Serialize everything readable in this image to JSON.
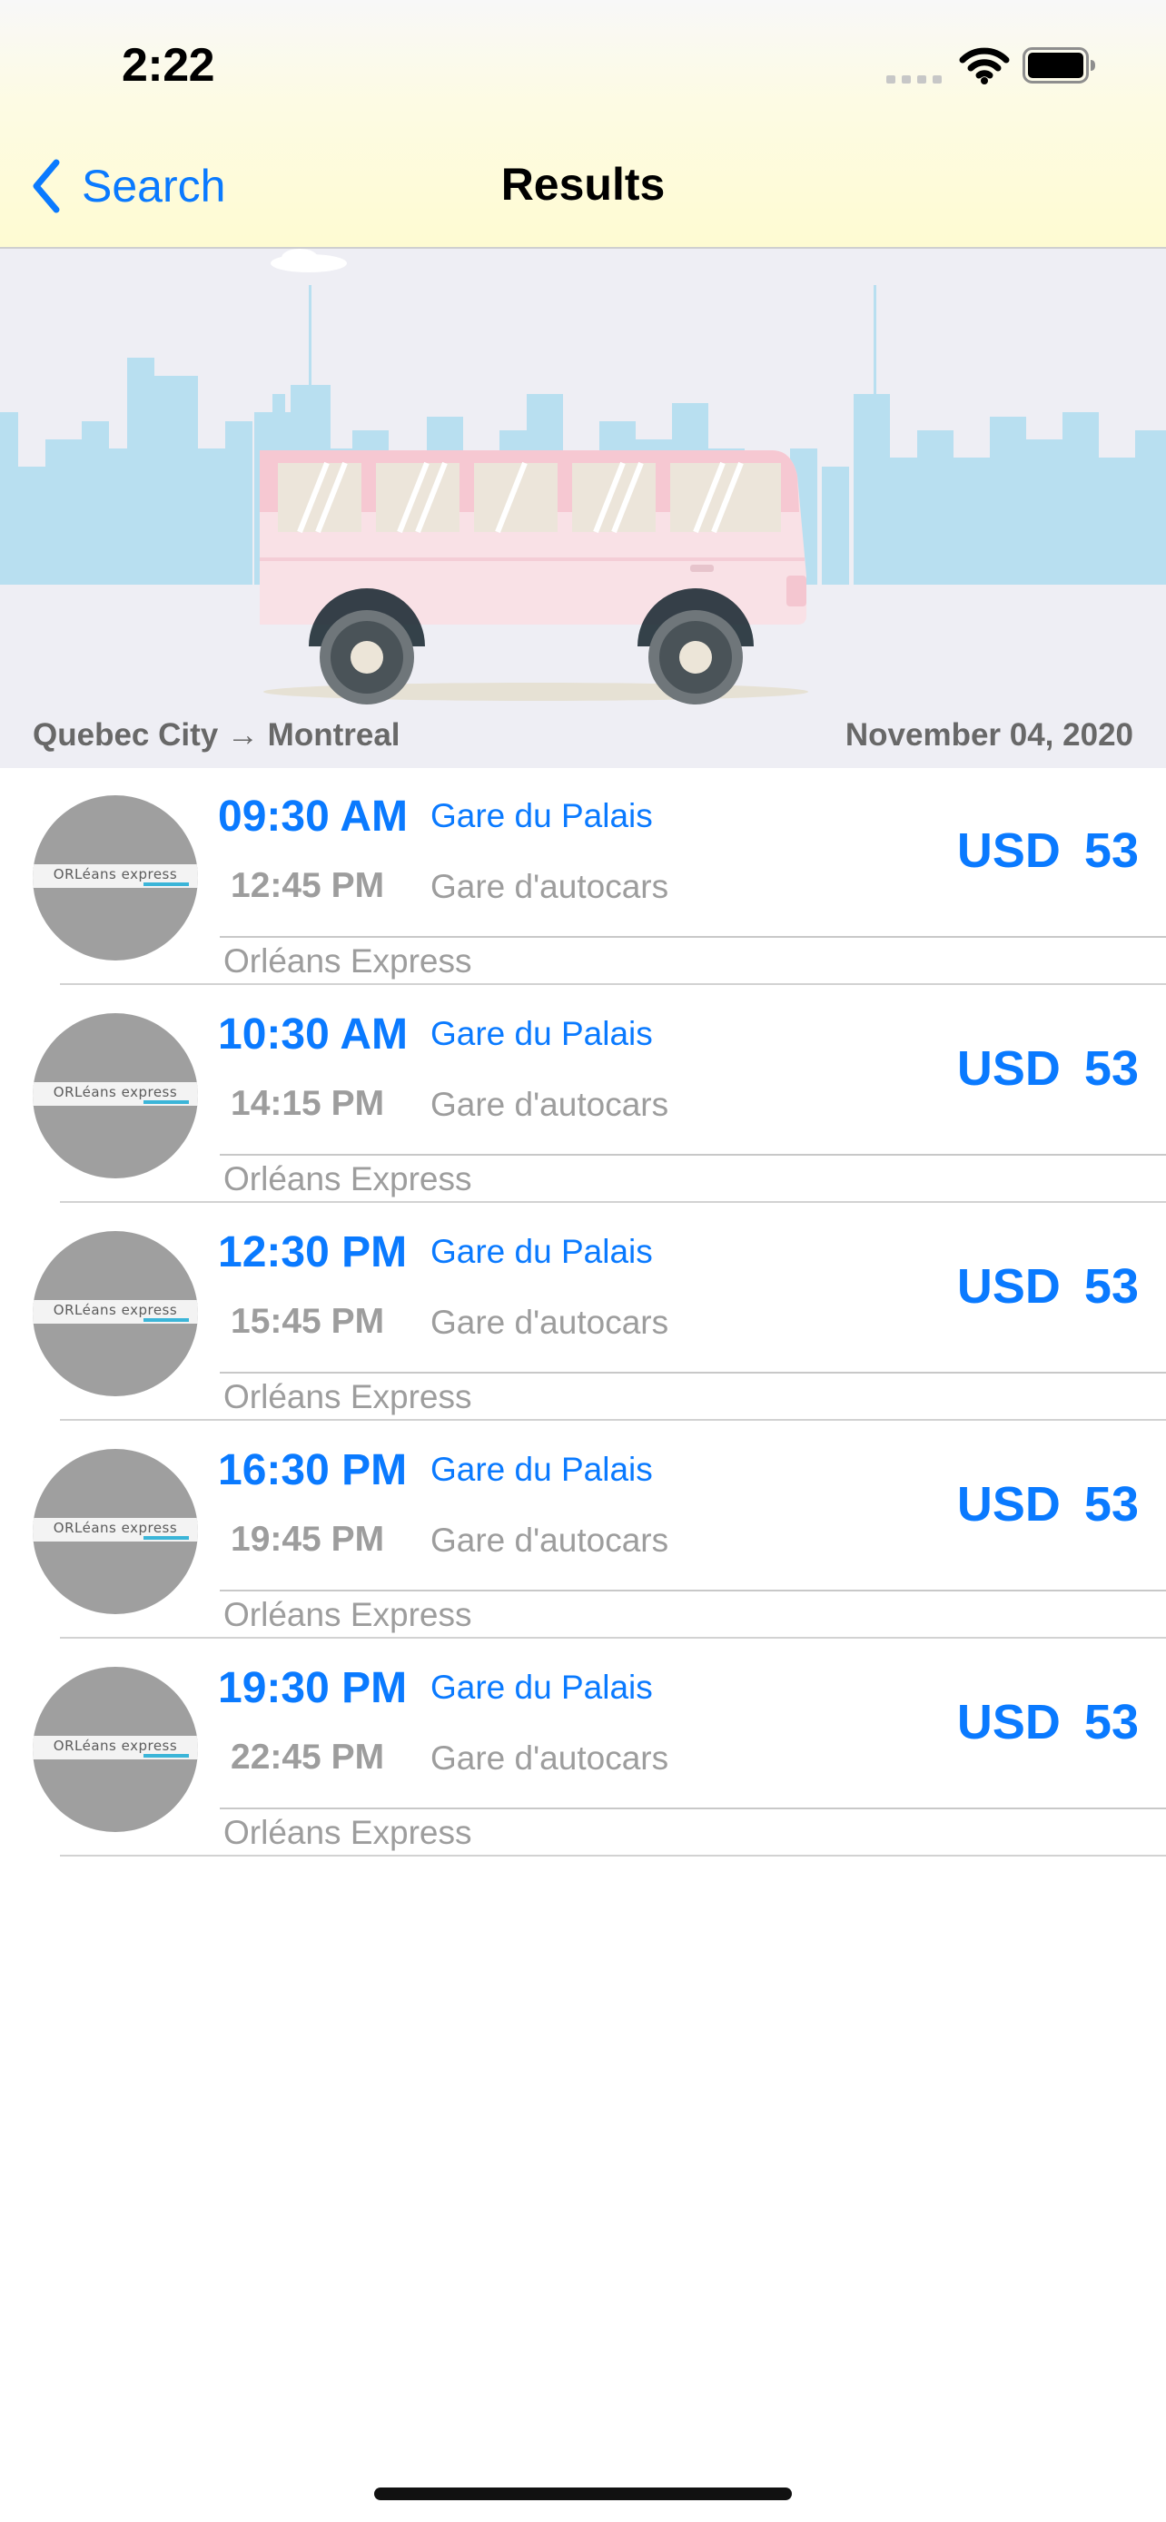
{
  "status_bar": {
    "time": "2:22",
    "icons": [
      "cellular-signal-icon",
      "wifi-icon",
      "battery-icon"
    ]
  },
  "nav": {
    "back_label": "Search",
    "title": "Results"
  },
  "banner": {
    "illustration": "bus-city-skyline",
    "route": "Quebec City → Montreal",
    "date": "November 04, 2020"
  },
  "colors": {
    "accent": "#0a7aff",
    "muted_text": "#9d9d9d",
    "header_gradient_end": "#fefbd2"
  },
  "results": [
    {
      "logo_text": "ORLéans express",
      "departure_time": "09:30 AM",
      "departure_station": "Gare du Palais",
      "arrival_time": "12:45 PM",
      "arrival_station": "Gare d'autocars",
      "currency": "USD",
      "price": "53",
      "operator": "Orléans Express"
    },
    {
      "logo_text": "ORLéans express",
      "departure_time": "10:30 AM",
      "departure_station": "Gare du Palais",
      "arrival_time": "14:15 PM",
      "arrival_station": "Gare d'autocars",
      "currency": "USD",
      "price": "53",
      "operator": "Orléans Express"
    },
    {
      "logo_text": "ORLéans express",
      "departure_time": "12:30 PM",
      "departure_station": "Gare du Palais",
      "arrival_time": "15:45 PM",
      "arrival_station": "Gare d'autocars",
      "currency": "USD",
      "price": "53",
      "operator": "Orléans Express"
    },
    {
      "logo_text": "ORLéans express",
      "departure_time": "16:30 PM",
      "departure_station": "Gare du Palais",
      "arrival_time": "19:45 PM",
      "arrival_station": "Gare d'autocars",
      "currency": "USD",
      "price": "53",
      "operator": "Orléans Express"
    },
    {
      "logo_text": "ORLéans express",
      "departure_time": "19:30 PM",
      "departure_station": "Gare du Palais",
      "arrival_time": "22:45 PM",
      "arrival_station": "Gare d'autocars",
      "currency": "USD",
      "price": "53",
      "operator": "Orléans Express"
    }
  ]
}
